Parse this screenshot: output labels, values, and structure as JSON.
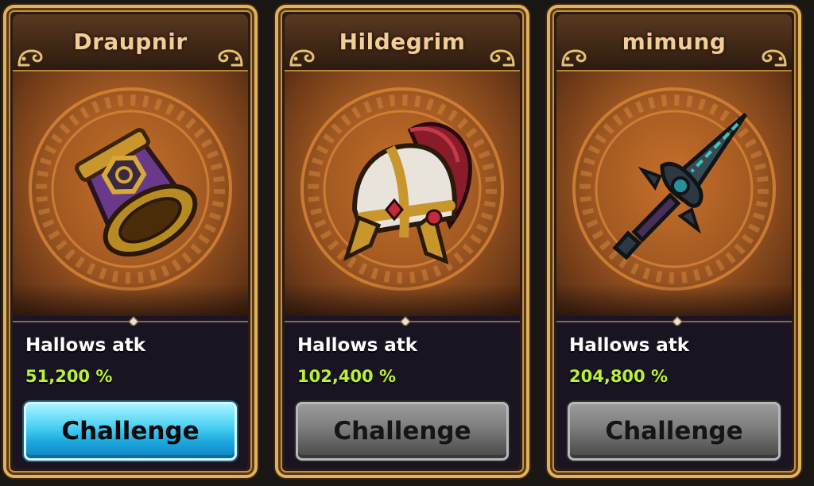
{
  "cards": [
    {
      "title": "Draupnir",
      "item_icon": "ring-icon",
      "stat_label": "Hallows atk",
      "stat_value": "51,200 %",
      "button_label": "Challenge",
      "button_state": "active"
    },
    {
      "title": "Hildegrim",
      "item_icon": "helmet-icon",
      "stat_label": "Hallows atk",
      "stat_value": "102,400 %",
      "button_label": "Challenge",
      "button_state": "disabled"
    },
    {
      "title": "mimung",
      "item_icon": "sword-icon",
      "stat_label": "Hallows atk",
      "stat_value": "204,800 %",
      "button_label": "Challenge",
      "button_state": "disabled"
    }
  ],
  "colors": {
    "frame_gold": "#e0b25a",
    "stat_value_green": "#b9f23a",
    "active_button_blue": "#1ba8df",
    "disabled_button_gray": "#7c7c7c"
  }
}
